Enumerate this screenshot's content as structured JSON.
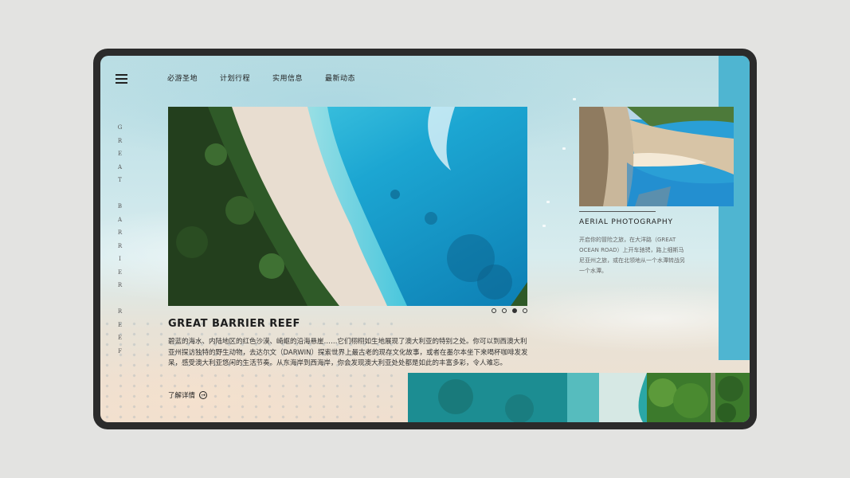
{
  "nav": {
    "menu_icon": "hamburger-icon",
    "items": [
      "必游圣地",
      "计划行程",
      "实用信息",
      "最新动态"
    ]
  },
  "vertical_label": "GREAT BARRIER REEF",
  "hero": {
    "title": "GREAT BARRIER REEF",
    "description": "碧蓝的海水、内陆地区的红色沙漠、崎岖的沿海悬崖……它们栩栩如生地展现了澳大利亚的特别之处。你可以到西澳大利亚州探访独特的野生动物，去达尔文（DARWIN）探索世界上最古老的现存文化故事，或者在墨尔本坐下来喝杯咖啡发发呆，感受澳大利亚悠闲的生活节奏。从东海岸到西海岸，你会发现澳大利亚处处都是如此的丰富多彩，令人难忘。",
    "more_label": "了解详情",
    "carousel": {
      "count": 4,
      "active_index": 2
    }
  },
  "side_card": {
    "title": "AERIAL PHOTOGRAPHY",
    "description": "开启你的冒险之旅，在大洋路（GREAT OCEAN ROAD）上开车驰骋，路上细斯马尼亚州之旅，或在北领地从一个水潭转战另一个水潭。"
  },
  "colors": {
    "accent": "#4fb5d1",
    "frame": "#2b2b2b",
    "text": "#1d1d1d"
  }
}
